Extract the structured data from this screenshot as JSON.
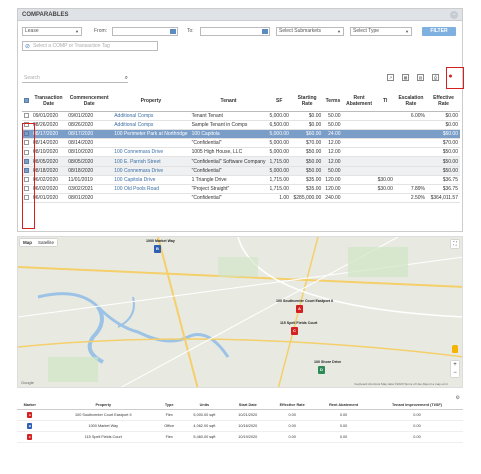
{
  "panel": {
    "title": "COMPARABLES",
    "collapse_icon": "−"
  },
  "filters": {
    "type_value": "Lease",
    "from_label": "From:",
    "from_value": "",
    "to_label": "To:",
    "to_value": "",
    "submarket_placeholder": "Select Submarkets",
    "type_placeholder": "Select Type",
    "filter_button": "FILTER",
    "tag_placeholder": "Select a COMP or Transaction Tag"
  },
  "search": {
    "placeholder": "Search"
  },
  "table": {
    "headers": [
      "",
      "Transaction Date",
      "Commencement Date",
      "Property",
      "Tenant",
      "SF",
      "Starting Rate",
      "Terms",
      "Rent Abatement",
      "TI",
      "Escalation Rate",
      "Effective Rate"
    ],
    "rows": [
      {
        "checked": false,
        "state": "",
        "cells": [
          "09/01/2020",
          "09/01/2020",
          "Additional Comps",
          "Tenant Tenant",
          "5,000.00",
          "$0.00",
          "50.00",
          "",
          "",
          "6.00%",
          "$0.00"
        ]
      },
      {
        "checked": false,
        "state": "",
        "cells": [
          "08/26/2020",
          "08/26/2020",
          "Additional Comps",
          "Sample Tenant in Comps",
          "6,500.00",
          "$0.00",
          "50.00",
          "",
          "",
          "",
          "$0.00"
        ]
      },
      {
        "checked": true,
        "state": "sel",
        "cells": [
          "08/17/2020",
          "08/17/2020",
          "100 Perimeter Park at Northridge",
          "100 Capitola",
          "5,000.00",
          "$60.00",
          "24.00",
          "",
          "",
          "",
          "$60.00"
        ]
      },
      {
        "checked": false,
        "state": "",
        "cells": [
          "08/14/2020",
          "08/14/2020",
          "",
          "\"Confidential\"",
          "5,000.00",
          "$70.00",
          "12.00",
          "",
          "",
          "",
          "$70.00"
        ]
      },
      {
        "checked": false,
        "state": "",
        "cells": [
          "08/10/2020",
          "08/10/2020",
          "100 Connemara Drive",
          "1005 High House, LLC",
          "5,000.00",
          "$50.00",
          "12.00",
          "",
          "",
          "",
          "$50.00"
        ]
      },
      {
        "checked": true,
        "state": "grey",
        "cells": [
          "08/05/2020",
          "08/05/2020",
          "100 E. Parrish Street",
          "\"Confidential\" Software Company",
          "1,715.00",
          "$50.00",
          "12.00",
          "",
          "",
          "",
          "$50.00"
        ]
      },
      {
        "checked": true,
        "state": "grey",
        "cells": [
          "08/18/2020",
          "08/18/2020",
          "100 Connemara Drive",
          "\"Confidential\"",
          "5,000.00",
          "$50.00",
          "50.00",
          "",
          "",
          "",
          "$50.00"
        ]
      },
      {
        "checked": false,
        "state": "",
        "cells": [
          "06/02/2020",
          "11/01/2019",
          "100 Capitola Drive",
          "1 Triangle Drive",
          "1,715.00",
          "$35.00",
          "120.00",
          "",
          "$30.00",
          "",
          "$36.75"
        ]
      },
      {
        "checked": false,
        "state": "",
        "cells": [
          "06/02/2020",
          "03/02/2021",
          "100 Old Pools Road",
          "\"Project Straight\"",
          "1,715.00",
          "$35.00",
          "120.00",
          "",
          "$30.00",
          "7.89%",
          "$36.75"
        ]
      },
      {
        "checked": false,
        "state": "",
        "cells": [
          "06/01/2020",
          "08/01/2020",
          "",
          "\"Confidential\"",
          "1.00",
          "$285,000.00",
          "240.00",
          "",
          "",
          "2.50%",
          "$364,011.57"
        ]
      }
    ]
  },
  "map": {
    "tabs": [
      "Map",
      "Satellite"
    ],
    "markers": [
      {
        "letter": "B",
        "label": "1000 Market Way",
        "color": "#2f5fb3"
      },
      {
        "letter": "A",
        "label": "100 Southcenter Court Eastport II",
        "color": "#d32020"
      },
      {
        "letter": "C",
        "label": "115 Spell Fields Court",
        "color": "#d32020"
      },
      {
        "letter": "D",
        "label": "100 Shore Drive",
        "color": "#2e8b57"
      }
    ],
    "attribution": "Keyboard shortcuts  Map data ©2020  Terms of Use  Report a map error",
    "logo": "Google"
  },
  "results": {
    "headers": [
      "Marker",
      "",
      "Property",
      "Type",
      "Units",
      "Start Date",
      "Effective Rate",
      "Rent Abatement",
      "Tenant Improvement (TI/SF)"
    ],
    "rows": [
      {
        "letter": "A",
        "color": "#d32020",
        "cells": [
          "",
          "100 Southcenter Court Eastport II",
          "Flex",
          "5,000.00 sqft",
          "10/21/2020",
          "0.00",
          "0.00",
          "0.00"
        ]
      },
      {
        "letter": "B",
        "color": "#2f5fb3",
        "cells": [
          "",
          "1000 Market Way",
          "Office",
          "4,062.00 sqft",
          "10/16/2020",
          "0.00",
          "0.00",
          "0.00"
        ]
      },
      {
        "letter": "C",
        "color": "#d32020",
        "cells": [
          "",
          "115 Spell Fields Court",
          "Flex",
          "5,460.00 sqft",
          "10/19/2020",
          "0.00",
          "0.00",
          "0.00"
        ]
      }
    ]
  }
}
